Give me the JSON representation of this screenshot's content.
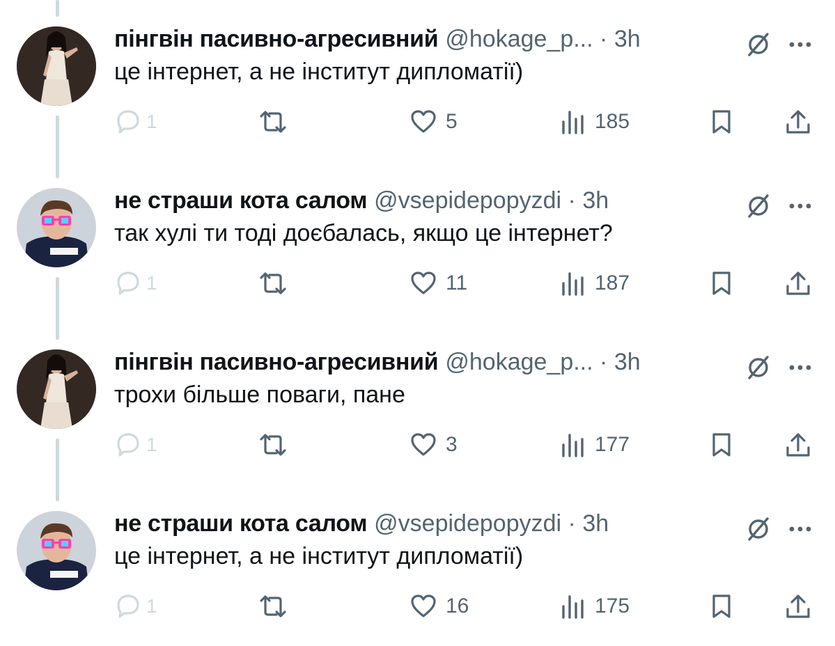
{
  "colors": {
    "text_primary": "#0f1419",
    "text_secondary": "#536471",
    "thread_line": "#cfd9de",
    "reply_muted": "#cfd9de"
  },
  "tweets": [
    {
      "name": "пінгвін пасивно-агресивний",
      "handle": "@hokage_p...",
      "dot": "·",
      "time": "3h",
      "text": "це інтернет, а не інститут дипломатії)",
      "avatar_icon": "woman-photo-avatar",
      "replies": "1",
      "likes": "5",
      "views": "185"
    },
    {
      "name": "не страши кота салом",
      "handle": "@vsepidepopyzdi",
      "dot": "·",
      "time": "3h",
      "text": "так хулі ти тоді доєбалась, якщо це інтернет?",
      "avatar_icon": "racer-sunglasses-avatar",
      "replies": "1",
      "likes": "11",
      "views": "187"
    },
    {
      "name": "пінгвін пасивно-агресивний",
      "handle": "@hokage_p...",
      "dot": "·",
      "time": "3h",
      "text": "трохи більше поваги, пане",
      "avatar_icon": "woman-photo-avatar",
      "replies": "1",
      "likes": "3",
      "views": "177"
    },
    {
      "name": "не страши кота салом",
      "handle": "@vsepidepopyzdi",
      "dot": "·",
      "time": "3h",
      "text": "це інтернет, а не інститут дипломатії)",
      "avatar_icon": "racer-sunglasses-avatar",
      "replies": "1",
      "likes": "16",
      "views": "175"
    }
  ]
}
